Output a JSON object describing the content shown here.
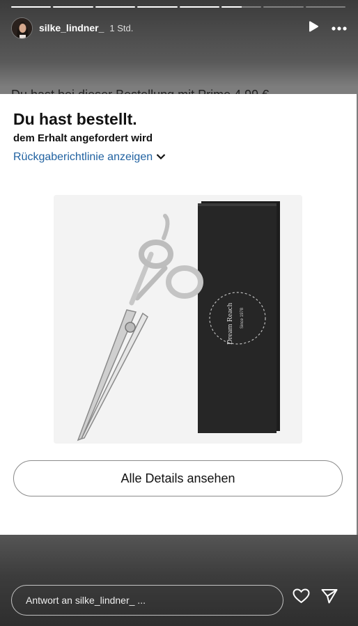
{
  "story": {
    "progress": [
      1,
      1,
      1,
      1,
      1,
      0.5,
      0,
      0
    ],
    "username": "silke_lindner_",
    "time": "1 Std.",
    "icons": {
      "play": "play-icon",
      "more": "more-icon"
    }
  },
  "peek_text": "Du hast bei dieser Bestellung mit Prime 4,99 €",
  "card": {
    "title": "Du hast bestellt.",
    "subtitle": "dem Erhalt angefordert wird",
    "policy_link": "Rückgaberichtlinie anzeigen",
    "product_brand": "Dream Reach",
    "product_since": "Since 1978",
    "details_button": "Alle Details ansehen"
  },
  "footer": {
    "reply_placeholder": "Antwort an silke_lindner_ ...",
    "icons": {
      "like": "heart-icon",
      "share": "send-icon"
    }
  }
}
